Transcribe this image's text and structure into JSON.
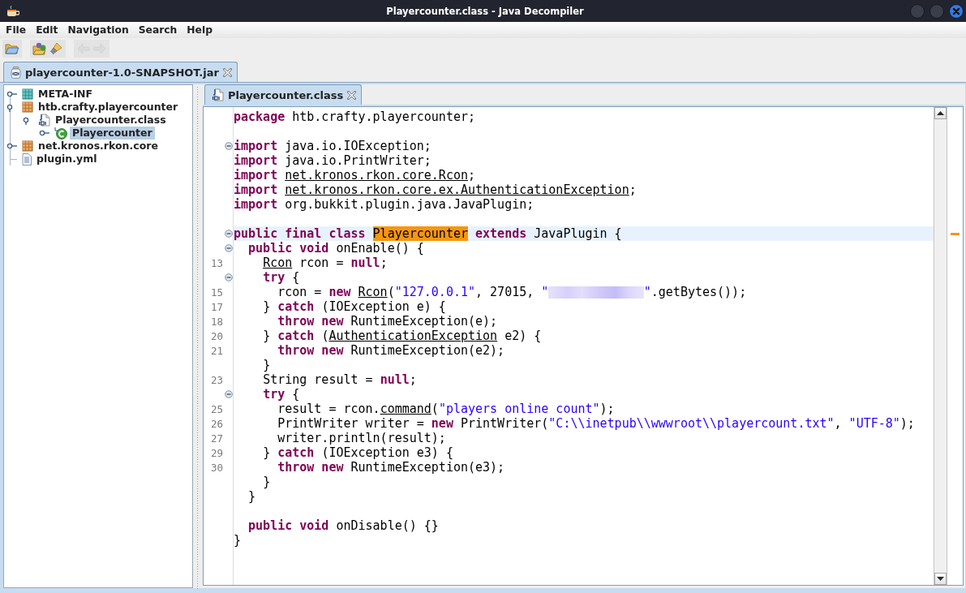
{
  "window": {
    "title": "Playercounter.class - Java Decompiler"
  },
  "menu": [
    "File",
    "Edit",
    "Navigation",
    "Search",
    "Help"
  ],
  "toolbar": [
    [
      {
        "kind": "open",
        "disabled": false
      }
    ],
    [
      {
        "kind": "open-type",
        "disabled": false
      },
      {
        "kind": "search",
        "disabled": false
      }
    ],
    [
      {
        "kind": "back",
        "disabled": true
      },
      {
        "kind": "forward",
        "disabled": true
      }
    ]
  ],
  "file_tabs": [
    {
      "label": "playercounter-1.0-SNAPSHOT.jar",
      "kind": "jar",
      "selected": true
    }
  ],
  "tree": [
    {
      "label": "META-INF",
      "kind": "folder",
      "expandable": true,
      "expanded": false,
      "selected": false
    },
    {
      "label": "htb.crafty.playercounter",
      "kind": "package",
      "expandable": true,
      "expanded": true,
      "selected": false,
      "children": [
        {
          "label": "Playercounter.class",
          "kind": "class-file",
          "expandable": true,
          "expanded": true,
          "selected": false,
          "children": [
            {
              "label": "Playercounter",
              "kind": "class",
              "expandable": true,
              "expanded": false,
              "selected": true
            }
          ]
        }
      ]
    },
    {
      "label": "net.kronos.rkon.core",
      "kind": "package",
      "expandable": true,
      "expanded": false,
      "selected": false
    },
    {
      "label": "plugin.yml",
      "kind": "text-file",
      "expandable": false,
      "selected": false
    }
  ],
  "editor_tabs": [
    {
      "label": "Playercounter.class",
      "kind": "class-file",
      "selected": true
    }
  ],
  "code": [
    {
      "fold": false,
      "current": false,
      "tokens": [
        {
          "kind": "keyword",
          "text": "package"
        },
        {
          "kind": "text",
          "text": " htb.crafty.playercounter;"
        }
      ]
    },
    {
      "fold": false,
      "current": false
    },
    {
      "fold": true,
      "current": false,
      "tokens": [
        {
          "kind": "keyword",
          "text": "import"
        },
        {
          "kind": "text",
          "text": " java.io.IOException;"
        }
      ]
    },
    {
      "fold": false,
      "current": false,
      "tokens": [
        {
          "kind": "keyword",
          "text": "import"
        },
        {
          "kind": "text",
          "text": " java.io.PrintWriter;"
        }
      ]
    },
    {
      "fold": false,
      "current": false,
      "tokens": [
        {
          "kind": "keyword",
          "text": "import"
        },
        {
          "kind": "link",
          "text": " net.kronos.rkon.core.Rcon"
        },
        {
          "kind": "text",
          "text": ";"
        }
      ]
    },
    {
      "fold": false,
      "current": false,
      "tokens": [
        {
          "kind": "keyword",
          "text": "import"
        },
        {
          "kind": "link",
          "text": " net.kronos.rkon.core.ex.AuthenticationException"
        },
        {
          "kind": "text",
          "text": ";"
        }
      ]
    },
    {
      "fold": false,
      "current": false,
      "tokens": [
        {
          "kind": "keyword",
          "text": "import"
        },
        {
          "kind": "text",
          "text": " org.bukkit.plugin.java.JavaPlugin;"
        }
      ]
    },
    {
      "fold": false,
      "current": false
    },
    {
      "fold": true,
      "current": true,
      "tokens": [
        {
          "kind": "keyword",
          "text": "public final class"
        },
        {
          "kind": "match",
          "text": " Playercounter"
        },
        {
          "kind": "keyword",
          "text": " extends"
        },
        {
          "kind": "text",
          "text": " JavaPlugin {"
        }
      ]
    },
    {
      "fold": true,
      "current": false,
      "tokens": [
        {
          "kind": "keyword",
          "text": "  public void"
        },
        {
          "kind": "text",
          "text": " onEnable() {"
        }
      ]
    },
    {
      "number": "13",
      "fold": false,
      "current": false,
      "tokens": [
        {
          "kind": "link",
          "text": "    Rcon"
        },
        {
          "kind": "text",
          "text": " rcon = "
        },
        {
          "kind": "keyword",
          "text": "null"
        },
        {
          "kind": "text",
          "text": ";"
        }
      ]
    },
    {
      "fold": true,
      "current": false,
      "tokens": [
        {
          "kind": "keyword",
          "text": "    try"
        },
        {
          "kind": "text",
          "text": " {"
        }
      ]
    },
    {
      "number": "15",
      "fold": false,
      "current": false,
      "tokens": [
        {
          "kind": "text",
          "text": "      rcon = "
        },
        {
          "kind": "keyword",
          "text": "new"
        },
        {
          "kind": "link",
          "text": " Rcon"
        },
        {
          "kind": "text",
          "text": "("
        },
        {
          "kind": "string",
          "text": "\"127.0.0.1\""
        },
        {
          "kind": "text",
          "text": ", 27015, "
        },
        {
          "kind": "string",
          "text": "\""
        },
        {
          "kind": "redacted"
        },
        {
          "kind": "string",
          "text": "\""
        },
        {
          "kind": "text",
          "text": ".getBytes());"
        }
      ]
    },
    {
      "number": "17",
      "fold": false,
      "current": false,
      "tokens": [
        {
          "kind": "text",
          "text": "    }"
        },
        {
          "kind": "keyword",
          "text": " catch"
        },
        {
          "kind": "text",
          "text": " (IOException e) {"
        }
      ]
    },
    {
      "number": "18",
      "fold": false,
      "current": false,
      "tokens": [
        {
          "kind": "keyword",
          "text": "      throw new"
        },
        {
          "kind": "text",
          "text": " RuntimeException(e);"
        }
      ]
    },
    {
      "number": "20",
      "fold": false,
      "current": false,
      "tokens": [
        {
          "kind": "text",
          "text": "    }"
        },
        {
          "kind": "keyword",
          "text": " catch"
        },
        {
          "kind": "text",
          "text": " ("
        },
        {
          "kind": "link",
          "text": "AuthenticationException"
        },
        {
          "kind": "text",
          "text": " e2) {"
        }
      ]
    },
    {
      "number": "21",
      "fold": false,
      "current": false,
      "tokens": [
        {
          "kind": "keyword",
          "text": "      throw new"
        },
        {
          "kind": "text",
          "text": " RuntimeException(e2);"
        }
      ]
    },
    {
      "fold": false,
      "current": false,
      "tokens": [
        {
          "kind": "text",
          "text": "    }"
        }
      ]
    },
    {
      "number": "23",
      "fold": false,
      "current": false,
      "tokens": [
        {
          "kind": "text",
          "text": "    String result = "
        },
        {
          "kind": "keyword",
          "text": "null"
        },
        {
          "kind": "text",
          "text": ";"
        }
      ]
    },
    {
      "fold": true,
      "current": false,
      "tokens": [
        {
          "kind": "keyword",
          "text": "    try"
        },
        {
          "kind": "text",
          "text": " {"
        }
      ]
    },
    {
      "number": "25",
      "fold": false,
      "current": false,
      "tokens": [
        {
          "kind": "text",
          "text": "      result = rcon."
        },
        {
          "kind": "link",
          "text": "command"
        },
        {
          "kind": "text",
          "text": "("
        },
        {
          "kind": "string",
          "text": "\"players online count\""
        },
        {
          "kind": "text",
          "text": ");"
        }
      ]
    },
    {
      "number": "26",
      "fold": false,
      "current": false,
      "tokens": [
        {
          "kind": "text",
          "text": "      PrintWriter writer = "
        },
        {
          "kind": "keyword",
          "text": "new"
        },
        {
          "kind": "text",
          "text": " PrintWriter("
        },
        {
          "kind": "string",
          "text": "\"C:\\\\inetpub\\\\wwwroot\\\\playercount.txt\""
        },
        {
          "kind": "text",
          "text": ", "
        },
        {
          "kind": "string",
          "text": "\"UTF-8\""
        },
        {
          "kind": "text",
          "text": ");"
        }
      ]
    },
    {
      "number": "27",
      "fold": false,
      "current": false,
      "tokens": [
        {
          "kind": "text",
          "text": "      writer.println(result);"
        }
      ]
    },
    {
      "number": "29",
      "fold": false,
      "current": false,
      "tokens": [
        {
          "kind": "text",
          "text": "    }"
        },
        {
          "kind": "keyword",
          "text": " catch"
        },
        {
          "kind": "text",
          "text": " (IOException e3) {"
        }
      ]
    },
    {
      "number": "30",
      "fold": false,
      "current": false,
      "tokens": [
        {
          "kind": "keyword",
          "text": "      throw new"
        },
        {
          "kind": "text",
          "text": " RuntimeException(e3);"
        }
      ]
    },
    {
      "fold": false,
      "current": false,
      "tokens": [
        {
          "kind": "text",
          "text": "    }"
        }
      ]
    },
    {
      "fold": false,
      "current": false,
      "tokens": [
        {
          "kind": "text",
          "text": "  }"
        }
      ]
    },
    {
      "fold": false,
      "current": false
    },
    {
      "fold": false,
      "current": false,
      "tokens": [
        {
          "kind": "keyword",
          "text": "  public void"
        },
        {
          "kind": "text",
          "text": " onDisable() {}"
        }
      ]
    },
    {
      "fold": false,
      "current": false,
      "tokens": [
        {
          "kind": "text",
          "text": "}"
        }
      ]
    }
  ]
}
